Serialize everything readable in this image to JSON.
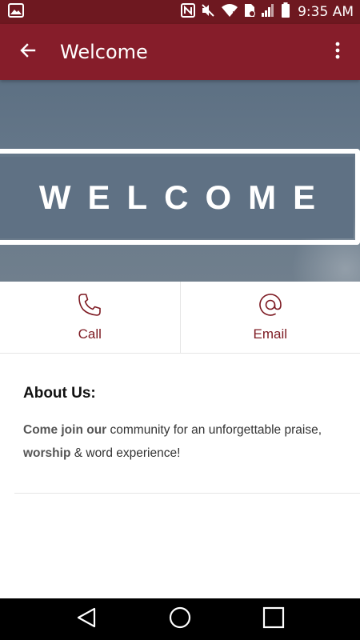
{
  "status_bar": {
    "time": "9:35 AM",
    "icons": [
      "image-notification-icon",
      "nfc-icon",
      "mute-icon",
      "wifi-icon",
      "sim-icon",
      "signal-icon",
      "battery-icon"
    ]
  },
  "app_bar": {
    "title": "Welcome",
    "back_icon": "arrow-back-icon",
    "menu_icon": "more-vert-icon"
  },
  "hero": {
    "banner_text": "WELCOME"
  },
  "actions": [
    {
      "label": "Call",
      "icon": "phone-icon"
    },
    {
      "label": "Email",
      "icon": "at-sign-icon"
    }
  ],
  "about": {
    "heading": "About Us:",
    "body_1": "Come join our",
    "body_2": " community for an unforgettable praise, ",
    "body_3": "worship",
    "body_4": " & word experience!"
  },
  "nav": {
    "buttons": [
      "back-triangle-icon",
      "home-circle-icon",
      "recents-square-icon"
    ]
  },
  "colors": {
    "status_bar": "#6e1820",
    "app_bar": "#861d2a",
    "accent": "#7d1a22",
    "hero": "#5f7184"
  }
}
